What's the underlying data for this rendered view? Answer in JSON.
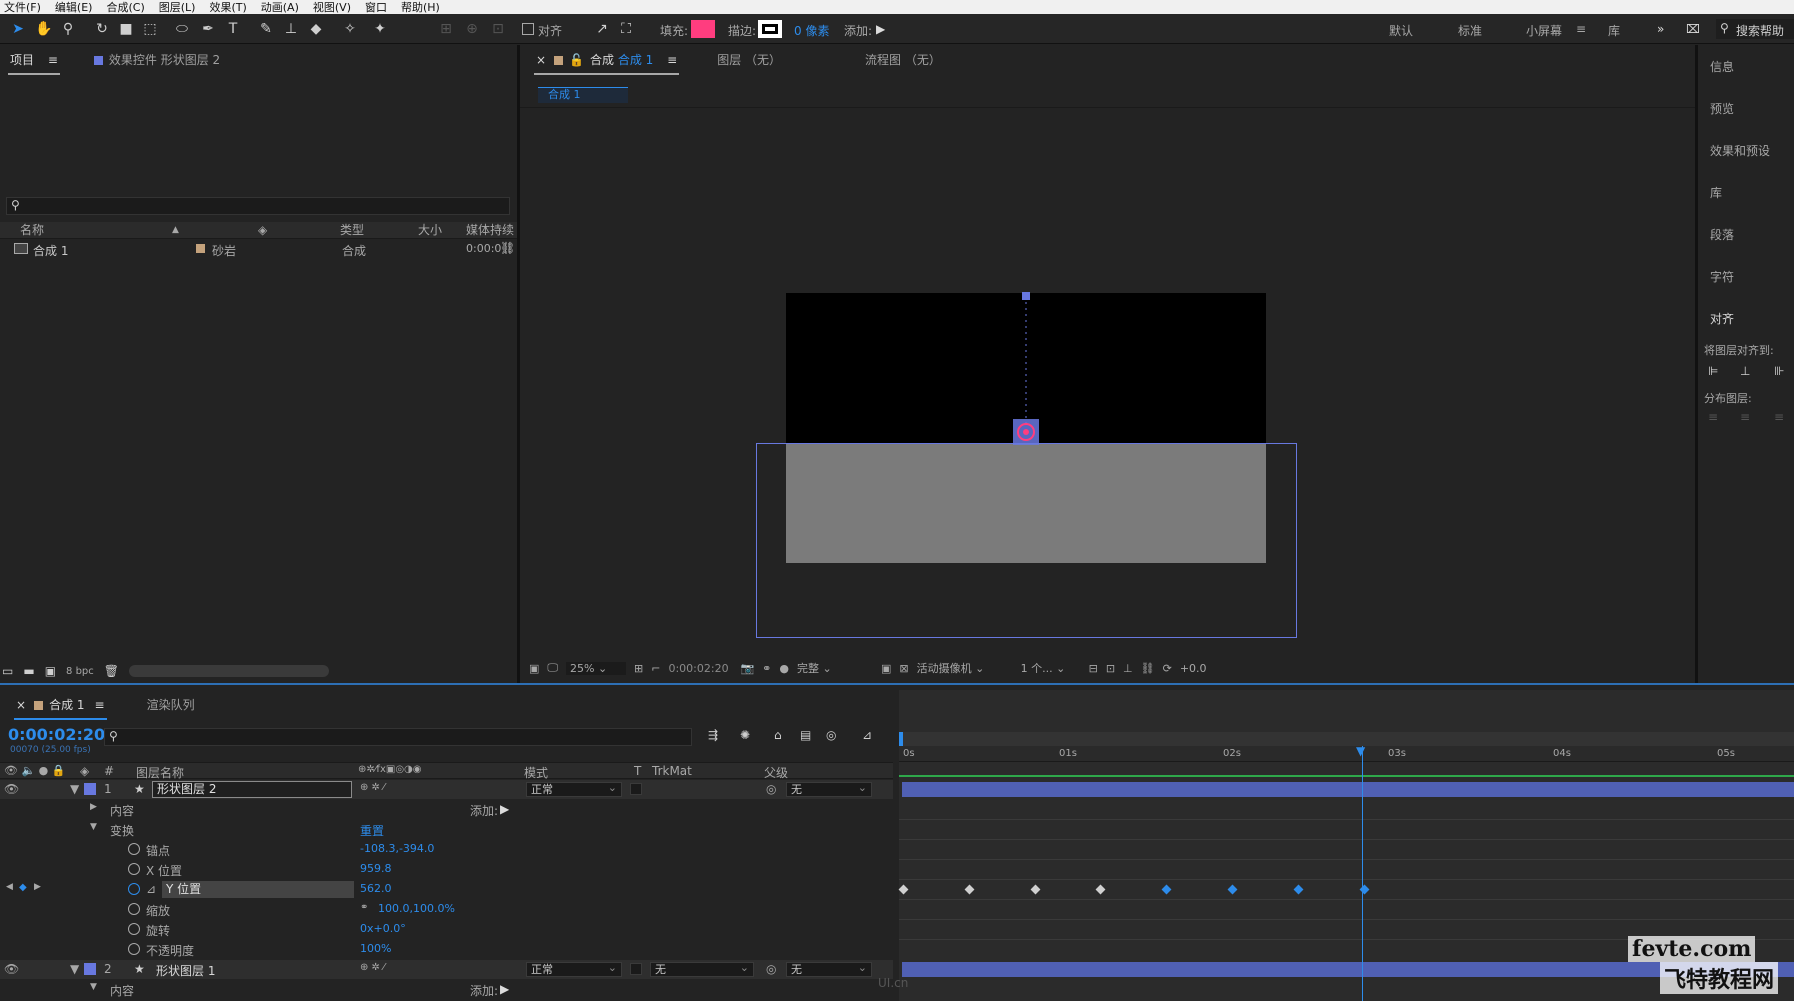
{
  "menu": [
    "文件(F)",
    "编辑(E)",
    "合成(C)",
    "图层(L)",
    "效果(T)",
    "动画(A)",
    "视图(V)",
    "窗口",
    "帮助(H)"
  ],
  "toolbar": {
    "align_label": "对齐",
    "fill_label": "填充:",
    "stroke_label": "描边:",
    "stroke_px": "0 像素",
    "add_label": "添加:",
    "fill_color": "#ff3d7f",
    "workspaces": [
      "默认",
      "标准",
      "小屏幕",
      "库"
    ],
    "active_workspace": "小屏幕",
    "search_help": "搜索帮助"
  },
  "project_panel": {
    "tab_project": "项目",
    "tab_effects": "效果控件 形状图层 2",
    "columns": [
      "名称",
      "类型",
      "大小",
      "媒体持续"
    ],
    "items": [
      {
        "name": "合成 1",
        "label": "砂岩",
        "type": "合成",
        "duration": "0:00:0"
      }
    ],
    "bpc": "8 bpc"
  },
  "viewer_panel": {
    "tab_comp_prefix": "合成",
    "tab_comp_name": "合成 1",
    "tab_layer": "图层 （无）",
    "tab_flow": "流程图 （无）",
    "sub_tab": "合成 1",
    "zoom": "25%",
    "timecode": "0:00:02:20",
    "quality": "完整",
    "camera": "活动摄像机",
    "views": "1 个...",
    "exposure": "+0.0"
  },
  "right_panel": {
    "items": [
      "信息",
      "预览",
      "效果和预设",
      "库",
      "段落",
      "字符",
      "对齐"
    ],
    "align_to": "将图层对齐到:",
    "distribute": "分布图层:"
  },
  "timeline": {
    "tab_comp": "合成 1",
    "tab_render": "渲染队列",
    "current_time": "0:00:02:20",
    "frame_info": "00070 (25.00 fps)",
    "columns": {
      "layer_name": "图层名称",
      "mode": "模式",
      "trkmat": "TrkMat",
      "parent": "父级"
    },
    "ruler": [
      "0s",
      "01s",
      "02s",
      "03s",
      "04s",
      "05s"
    ],
    "layers": [
      {
        "num": "1",
        "name": "形状图层 2",
        "mode": "正常",
        "parent": "无"
      },
      {
        "num": "2",
        "name": "形状图层 1",
        "mode": "正常",
        "trkmat": "无",
        "parent": "无"
      }
    ],
    "props": {
      "content": "内容",
      "add": "添加:",
      "transform": "变换",
      "reset": "重置",
      "anchor": "锚点",
      "anchor_val": "-108.3,-394.0",
      "xpos": "X 位置",
      "xpos_val": "959.8",
      "ypos": "Y 位置",
      "ypos_val": "562.0",
      "scale": "缩放",
      "scale_val": "100.0,100.0%",
      "rotation": "旋转",
      "rotation_val": "0x+0.0°",
      "opacity": "不透明度",
      "opacity_val": "100%"
    },
    "keyframes_time_s": [
      0.0,
      0.4,
      0.8,
      1.2,
      1.6,
      2.0,
      2.4,
      2.8
    ]
  },
  "watermark": {
    "site": "fevte.com",
    "brand": "飞特教程网",
    "sub": "UI.cn"
  }
}
